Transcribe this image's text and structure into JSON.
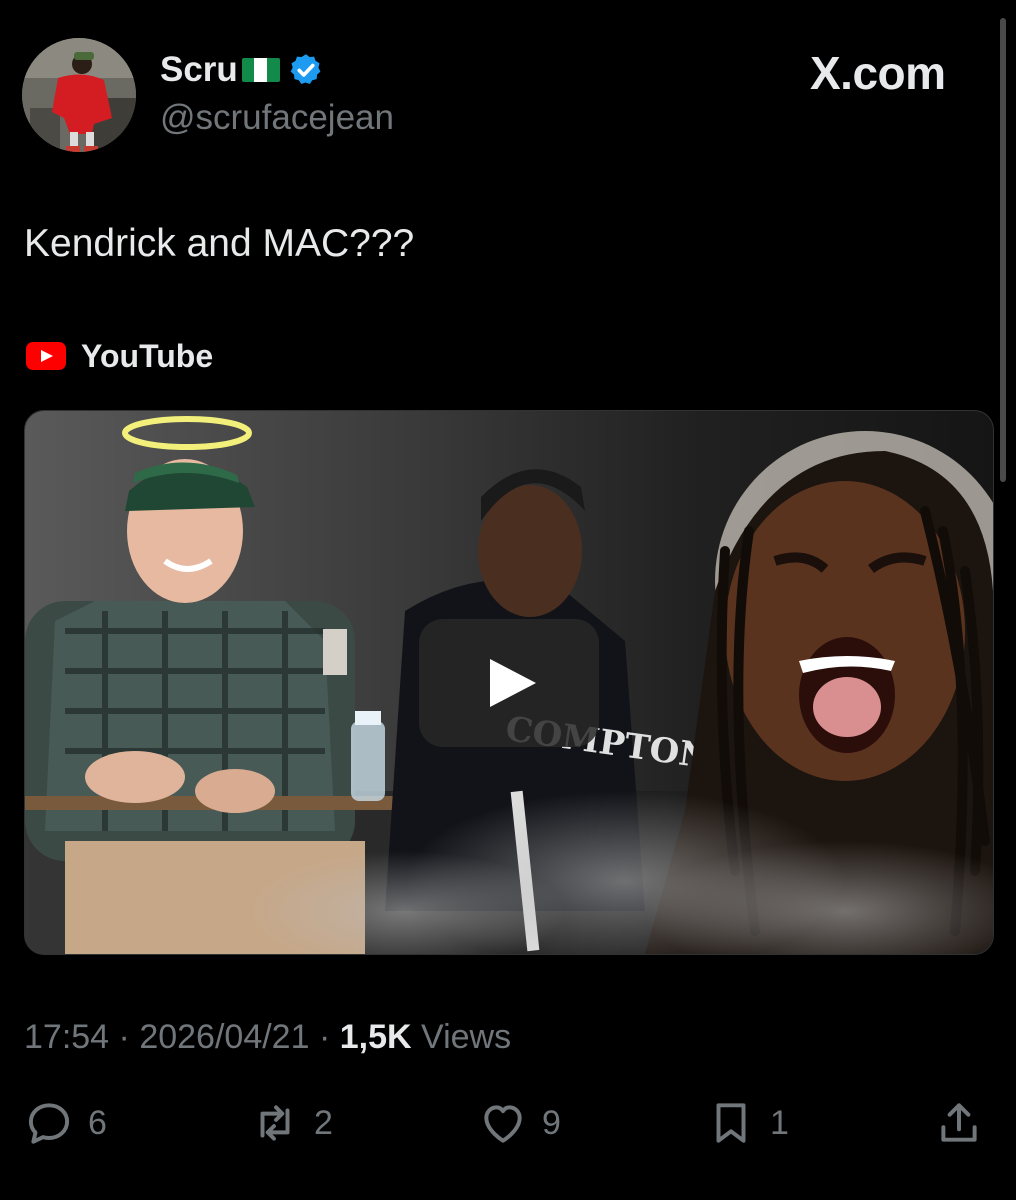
{
  "author": {
    "name": "Scru",
    "handle": "@scrufacejean",
    "flag": "nigeria-flag-icon",
    "verified_color": "#1d9bf0"
  },
  "brand": {
    "label": "X.com"
  },
  "tweet": {
    "text": "Kendrick and MAC???"
  },
  "link_card": {
    "source_icon": "youtube-icon",
    "source": "YouTube"
  },
  "meta": {
    "time": "17:54",
    "date": "2026/04/21",
    "views_count": "1,5K",
    "views_label": "Views"
  },
  "actions": {
    "replies": "6",
    "reposts": "2",
    "likes": "9",
    "bookmarks": "1"
  },
  "colors": {
    "background": "#000000",
    "text": "#e7e9ea",
    "muted": "#71767b",
    "youtube": "#ff0000"
  }
}
